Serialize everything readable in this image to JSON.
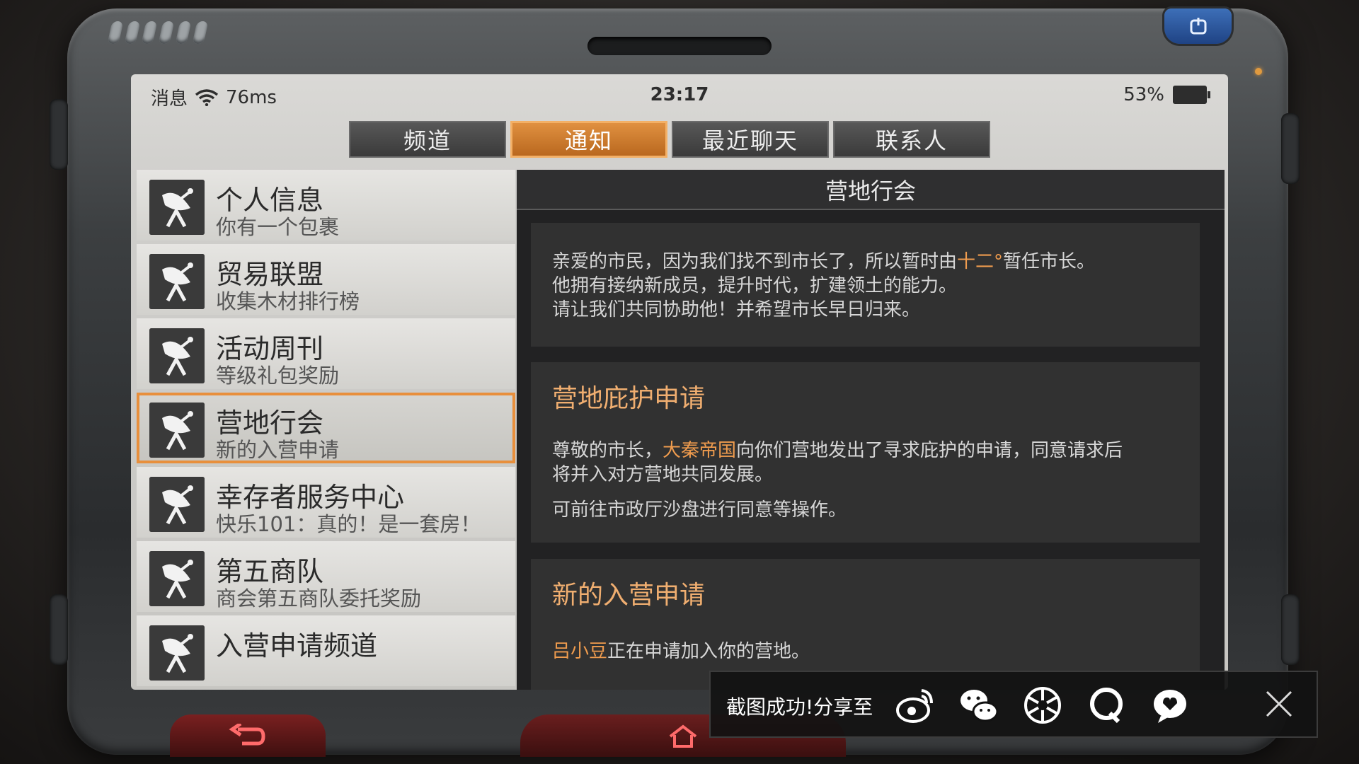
{
  "status": {
    "label": "消息",
    "ping": "76ms",
    "time": "23:17",
    "battery": "53%"
  },
  "tabs": [
    {
      "label": "频道",
      "active": false
    },
    {
      "label": "通知",
      "active": true
    },
    {
      "label": "最近聊天",
      "active": false
    },
    {
      "label": "联系人",
      "active": false
    }
  ],
  "list": [
    {
      "title": "个人信息",
      "subtitle": "你有一个包裹"
    },
    {
      "title": "贸易联盟",
      "subtitle": "收集木材排行榜"
    },
    {
      "title": "活动周刊",
      "subtitle": "等级礼包奖励"
    },
    {
      "title": "营地行会",
      "subtitle": "新的入营申请",
      "selected": true
    },
    {
      "title": "幸存者服务中心",
      "subtitle": "快乐101：真的！是一套房！"
    },
    {
      "title": "第五商队",
      "subtitle": "商会第五商队委托奖励"
    },
    {
      "title": "入营申请频道",
      "subtitle": ""
    }
  ],
  "panel": {
    "title": "营地行会",
    "notice": {
      "line1_pre": "亲爱的市民，因为我们找不到市长了，所以暂时由",
      "line1_name": "十二°",
      "line1_post": "暂任市长。",
      "line2": "他拥有接纳新成员，提升时代，扩建领土的能力。",
      "line3": "请让我们共同协助他！并希望市长早日归来。"
    },
    "protect": {
      "heading": "营地庇护申请",
      "text_pre": "尊敬的市长，",
      "text_name": "大秦帝国",
      "text_post": "向你们营地发出了寻求庇护的申请，同意请求后",
      "text_line2": "将并入对方营地共同发展。",
      "note": "可前往市政厅沙盘进行同意等操作。"
    },
    "join": {
      "heading": "新的入营申请",
      "name": "吕小豆",
      "text": "正在申请加入你的营地。"
    }
  },
  "share": {
    "text": "截图成功!分享至",
    "targets": [
      "weibo-icon",
      "wechat-icon",
      "moments-icon",
      "qq-icon",
      "qzone-icon"
    ]
  },
  "colors": {
    "accent": "#e88f3c",
    "highlight": "#f09c4e"
  }
}
